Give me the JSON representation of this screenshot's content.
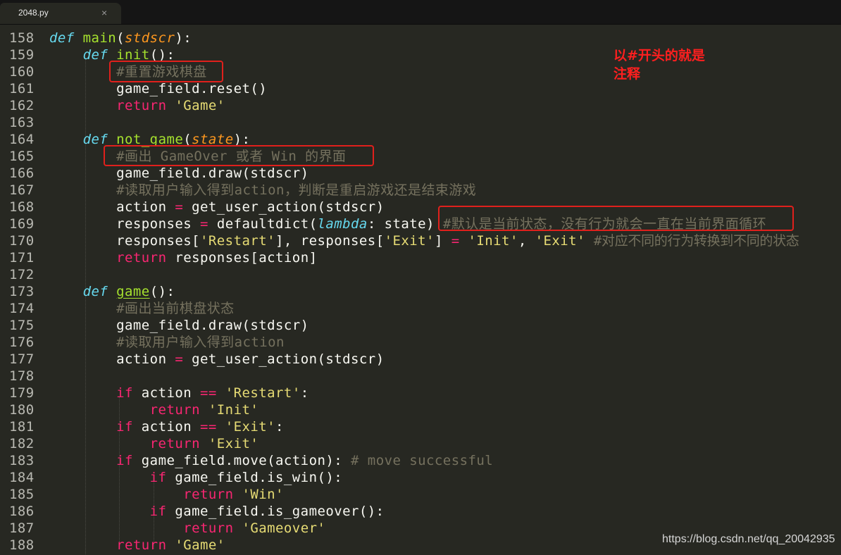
{
  "tab": {
    "filename": "2048.py",
    "close_glyph": "×"
  },
  "annotation": {
    "line1": "以#开头的就是",
    "line2": "注释"
  },
  "watermark": "https://blog.csdn.net/qq_20042935",
  "code": {
    "line_numbers": [
      "158",
      "159",
      "160",
      "161",
      "162",
      "163",
      "164",
      "165",
      "166",
      "167",
      "168",
      "169",
      "170",
      "171",
      "172",
      "173",
      "174",
      "175",
      "176",
      "177",
      "178",
      "179",
      "180",
      "181",
      "182",
      "183",
      "184",
      "185",
      "186",
      "187",
      "188"
    ],
    "l158": {
      "kw": "def",
      "name": "main",
      "p1": "(",
      "param": "stdscr",
      "p2": "):"
    },
    "l159": {
      "kw": "def",
      "name": "init",
      "p": "():"
    },
    "l160": {
      "cmt": "#重置游戏棋盘"
    },
    "l161": {
      "text": "game_field.reset()"
    },
    "l162": {
      "kw": "return",
      "str": "'Game'"
    },
    "l164": {
      "kw": "def",
      "name": "not_game",
      "p1": "(",
      "param": "state",
      "p2": "):"
    },
    "l165": {
      "cmt": "#画出 GameOver 或者 Win 的界面"
    },
    "l166": {
      "text": "game_field.draw(stdscr)"
    },
    "l167": {
      "cmt": "#读取用户输入得到action，判断是重启游戏还是结束游戏"
    },
    "l168": {
      "a": "action",
      "op": "=",
      "b": "get_user_action(stdscr)"
    },
    "l169": {
      "a": "responses",
      "op": "=",
      "b": "defaultdict(",
      "lamb": "lambda",
      "c": ": state)",
      "cmt": "#默认是当前状态，没有行为就会一直在当前界面循环"
    },
    "l170": {
      "a": "responses[",
      "s1": "'Restart'",
      "b": "], responses[",
      "s2": "'Exit'",
      "c": "]",
      "op": "=",
      "s3": "'Init'",
      "d": ",",
      "s4": "'Exit'",
      "cmt": "#对应不同的行为转换到不同的状态"
    },
    "l171": {
      "kw": "return",
      "text": "responses[action]"
    },
    "l173": {
      "kw": "def",
      "name": "game",
      "p": "():"
    },
    "l174": {
      "cmt": "#画出当前棋盘状态"
    },
    "l175": {
      "text": "game_field.draw(stdscr)"
    },
    "l176": {
      "cmt": "#读取用户输入得到action"
    },
    "l177": {
      "a": "action",
      "op": "=",
      "b": "get_user_action(stdscr)"
    },
    "l179": {
      "kw": "if",
      "a": "action",
      "op": "==",
      "str": "'Restart'",
      "c": ":"
    },
    "l180": {
      "kw": "return",
      "str": "'Init'"
    },
    "l181": {
      "kw": "if",
      "a": "action",
      "op": "==",
      "str": "'Exit'",
      "c": ":"
    },
    "l182": {
      "kw": "return",
      "str": "'Exit'"
    },
    "l183": {
      "kw": "if",
      "text": "game_field.move(action):",
      "cmt": "# move successful"
    },
    "l184": {
      "kw": "if",
      "text": "game_field.is_win():"
    },
    "l185": {
      "kw": "return",
      "str": "'Win'"
    },
    "l186": {
      "kw": "if",
      "text": "game_field.is_gameover():"
    },
    "l187": {
      "kw": "return",
      "str": "'Gameover'"
    },
    "l188": {
      "kw": "return",
      "str": "'Game'"
    }
  },
  "colors": {
    "background": "#272822",
    "keyword": "#66d9ef",
    "control": "#f92672",
    "function": "#a6e22e",
    "parameter": "#fd971f",
    "string": "#e6db74",
    "comment": "#75715e",
    "highlight_box": "#e0201c"
  }
}
